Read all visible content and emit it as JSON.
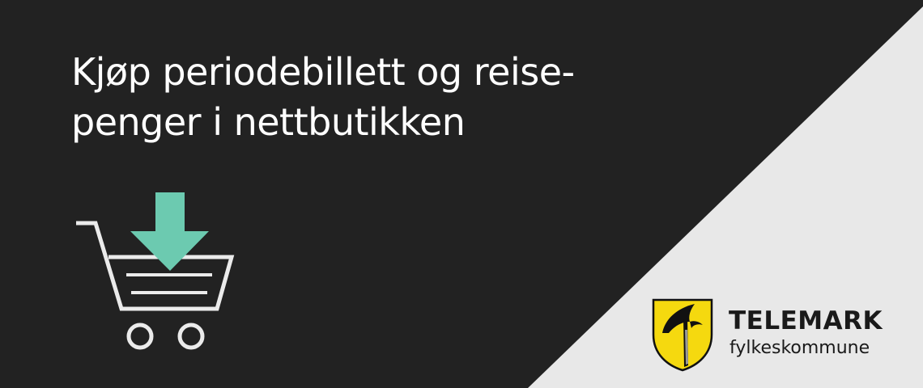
{
  "headline": {
    "line1": "Kjøp periodebillett og reise-",
    "line2": "penger i nettbutikken"
  },
  "icon": {
    "name": "shopping-cart-download-icon",
    "arrow_color": "#6ccab0",
    "cart_color": "#ebebeb"
  },
  "logo": {
    "name": "TELEMARK",
    "subtitle": "fylkeskommune",
    "shield_color": "#f5d90f"
  },
  "colors": {
    "background": "#222222",
    "corner": "#e8e8e8",
    "text": "#ffffff"
  }
}
